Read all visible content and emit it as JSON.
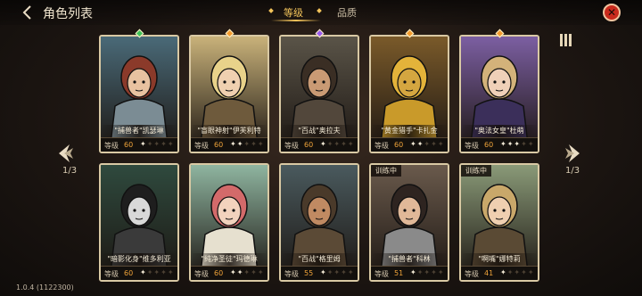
{
  "header": {
    "title": "角色列表",
    "back_icon": "back-arrow-icon",
    "close_icon": "close-icon"
  },
  "tabs": [
    {
      "label": "等级",
      "active": true
    },
    {
      "label": "品质",
      "active": false
    }
  ],
  "pagination": {
    "left_indicator": "1/3",
    "right_indicator": "1/3"
  },
  "version": "1.0.4 (1122300)",
  "colors": {
    "accent": "#f3c45b",
    "level_value": "#f0a43a",
    "close_button": "#c92a1c",
    "gem_green": "#3fc25a",
    "gem_orange": "#f29a2e",
    "gem_purple": "#9a5cf0"
  },
  "cards": [
    {
      "name": "\"捕兽者\"凯瑟琳",
      "level_label": "等级",
      "level": "60",
      "stars": 1,
      "max_stars": 5,
      "gem": "green",
      "training": ""
    },
    {
      "name": "\"盲眼神射\"伊芙利特",
      "level_label": "等级",
      "level": "60",
      "stars": 2,
      "max_stars": 5,
      "gem": "orange",
      "training": ""
    },
    {
      "name": "\"百战\"奥拉夫",
      "level_label": "等级",
      "level": "60",
      "stars": 1,
      "max_stars": 5,
      "gem": "purple",
      "training": ""
    },
    {
      "name": "\"黄金猎手\"卡扎金",
      "level_label": "等级",
      "level": "60",
      "stars": 2,
      "max_stars": 5,
      "gem": "orange",
      "training": ""
    },
    {
      "name": "\"奥法女皇\"杜萌",
      "level_label": "等级",
      "level": "60",
      "stars": 3,
      "max_stars": 5,
      "gem": "orange",
      "training": ""
    },
    {
      "name": "\"暗影化身\"维多利亚",
      "level_label": "等级",
      "level": "60",
      "stars": 1,
      "max_stars": 5,
      "gem": "",
      "training": ""
    },
    {
      "name": "\"纯净圣徒\"玛德琳",
      "level_label": "等级",
      "level": "60",
      "stars": 2,
      "max_stars": 5,
      "gem": "",
      "training": ""
    },
    {
      "name": "\"百战\"格里姆",
      "level_label": "等级",
      "level": "55",
      "stars": 1,
      "max_stars": 5,
      "gem": "",
      "training": ""
    },
    {
      "name": "\"捕兽者\"科林",
      "level_label": "等级",
      "level": "51",
      "stars": 1,
      "max_stars": 5,
      "gem": "",
      "training": "训练中"
    },
    {
      "name": "\"啊嘴\"娜特莉",
      "level_label": "等级",
      "level": "41",
      "stars": 1,
      "max_stars": 5,
      "gem": "",
      "training": "训练中"
    }
  ]
}
